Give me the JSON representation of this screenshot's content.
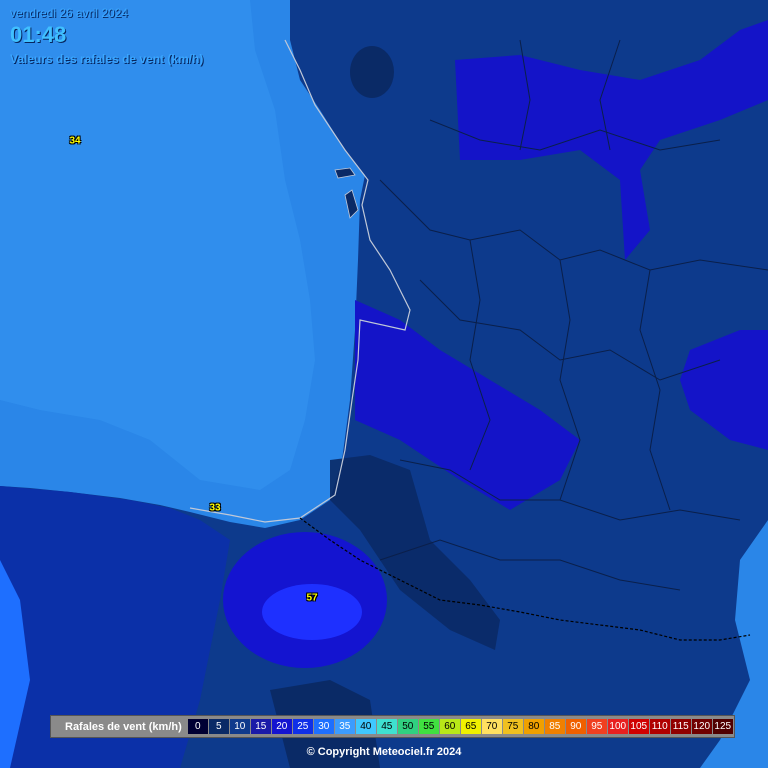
{
  "header": {
    "date": "vendredi 26 avril 2024",
    "time": "01:48",
    "subtitle": "Valeurs des rafales de vent (km/h)"
  },
  "station_values": [
    {
      "id": "ocean-north",
      "value": "34"
    },
    {
      "id": "biarritz-coast",
      "value": "33"
    },
    {
      "id": "offshore-south",
      "value": "57"
    }
  ],
  "legend": {
    "title": "Rafales de vent (km/h)",
    "steps": [
      {
        "label": "0",
        "color": "#000033"
      },
      {
        "label": "5",
        "color": "#0a2a66"
      },
      {
        "label": "10",
        "color": "#0f3a8c"
      },
      {
        "label": "15",
        "color": "#1a1aa8"
      },
      {
        "label": "20",
        "color": "#1414d0"
      },
      {
        "label": "25",
        "color": "#1030e8"
      },
      {
        "label": "30",
        "color": "#1e6fff"
      },
      {
        "label": "35",
        "color": "#3c9cff"
      },
      {
        "label": "40",
        "color": "#40c8ff"
      },
      {
        "label": "45",
        "color": "#3fe0d0"
      },
      {
        "label": "50",
        "color": "#30d080"
      },
      {
        "label": "55",
        "color": "#40e040"
      },
      {
        "label": "60",
        "color": "#b8e818"
      },
      {
        "label": "65",
        "color": "#f0f000"
      },
      {
        "label": "70",
        "color": "#ffe060"
      },
      {
        "label": "75",
        "color": "#f0c020"
      },
      {
        "label": "80",
        "color": "#f0a000"
      },
      {
        "label": "85",
        "color": "#f08000"
      },
      {
        "label": "90",
        "color": "#f06000"
      },
      {
        "label": "95",
        "color": "#f04020"
      },
      {
        "label": "100",
        "color": "#e82020"
      },
      {
        "label": "105",
        "color": "#d00000"
      },
      {
        "label": "110",
        "color": "#b00000"
      },
      {
        "label": "115",
        "color": "#900000"
      },
      {
        "label": "120",
        "color": "#700000"
      },
      {
        "label": "125",
        "color": "#500000"
      }
    ]
  },
  "copyright": "© Copyright Meteociel.fr 2024"
}
